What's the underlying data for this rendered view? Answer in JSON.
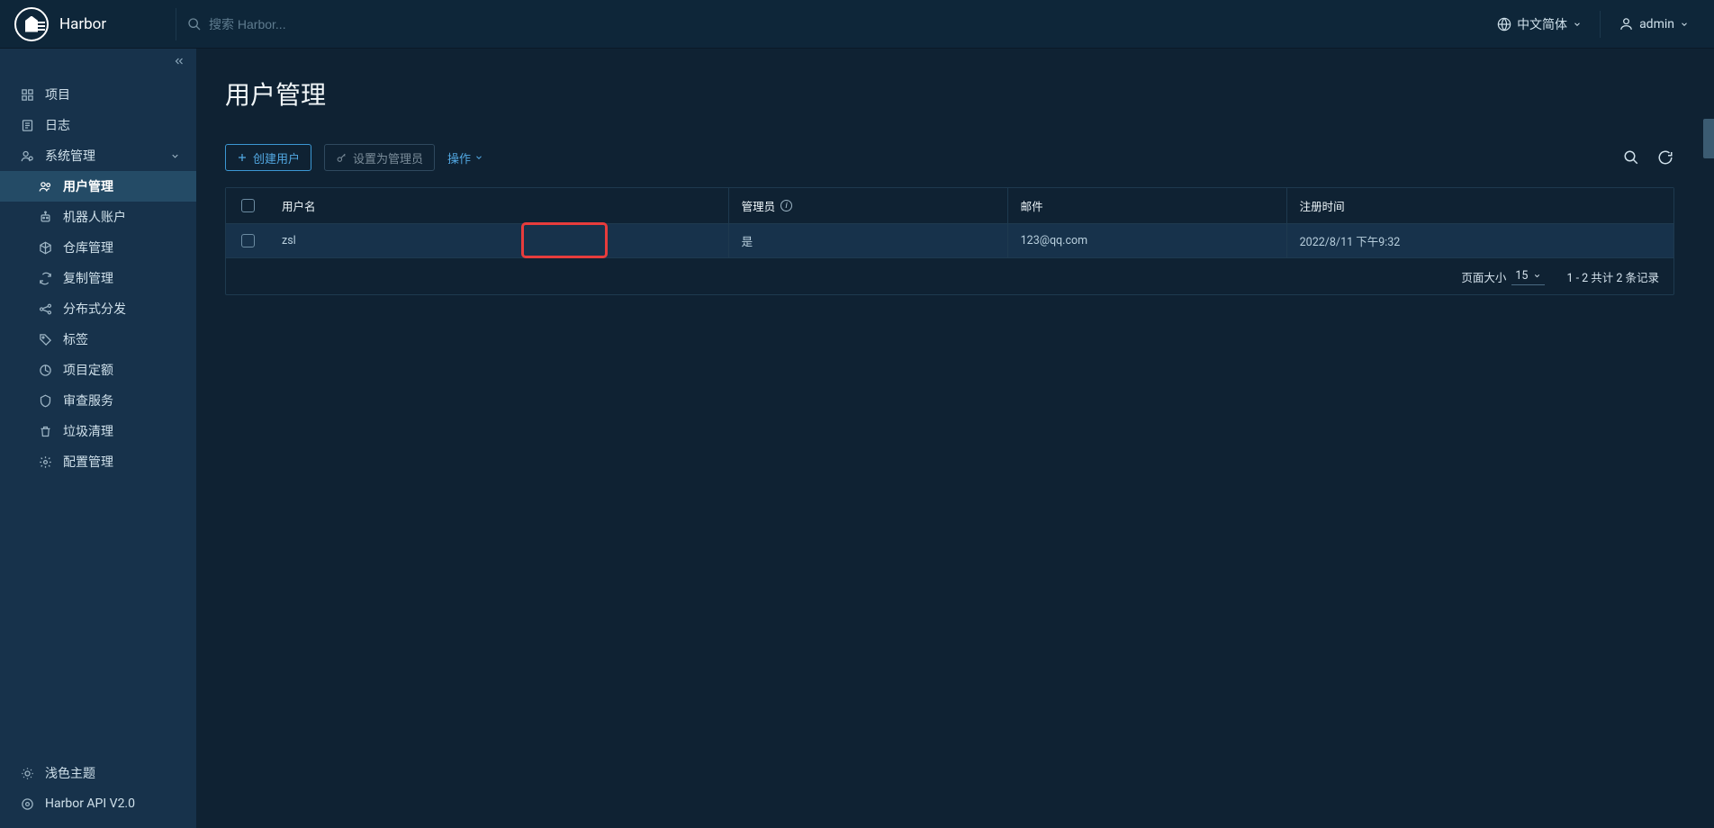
{
  "header": {
    "brand": "Harbor",
    "search_placeholder": "搜索 Harbor...",
    "language_label": "中文简体",
    "user_label": "admin"
  },
  "sidebar": {
    "items": [
      {
        "label": "项目",
        "iconName": "projects-icon"
      },
      {
        "label": "日志",
        "iconName": "logs-icon"
      },
      {
        "label": "系统管理",
        "iconName": "admin-icon",
        "expandable": true
      }
    ],
    "sub_items": [
      {
        "label": "用户管理",
        "iconName": "users-icon",
        "selected": true
      },
      {
        "label": "机器人账户",
        "iconName": "robot-icon"
      },
      {
        "label": "仓库管理",
        "iconName": "registry-icon"
      },
      {
        "label": "复制管理",
        "iconName": "replication-icon"
      },
      {
        "label": "分布式分发",
        "iconName": "distribution-icon"
      },
      {
        "label": "标签",
        "iconName": "labels-icon"
      },
      {
        "label": "项目定额",
        "iconName": "quota-icon"
      },
      {
        "label": "审查服务",
        "iconName": "scan-icon"
      },
      {
        "label": "垃圾清理",
        "iconName": "gc-icon"
      },
      {
        "label": "配置管理",
        "iconName": "config-icon"
      }
    ],
    "footer": [
      {
        "label": "浅色主题",
        "iconName": "theme-icon"
      },
      {
        "label": "Harbor API V2.0",
        "iconName": "api-icon"
      }
    ]
  },
  "main": {
    "title": "用户管理",
    "toolbar": {
      "create_label": "创建用户",
      "set_admin_label": "设置为管理员",
      "actions_label": "操作"
    },
    "table": {
      "columns": {
        "username": "用户名",
        "admin": "管理员",
        "email": "邮件",
        "reg_time": "注册时间"
      },
      "rows": [
        {
          "username": "zsl",
          "admin": "是",
          "email": "123@qq.com",
          "reg_time": "2022/8/11 下午9:32"
        }
      ],
      "footer": {
        "page_size_label": "页面大小",
        "page_size_value": "15",
        "range_text": "1 - 2 共计 2 条记录"
      }
    }
  }
}
